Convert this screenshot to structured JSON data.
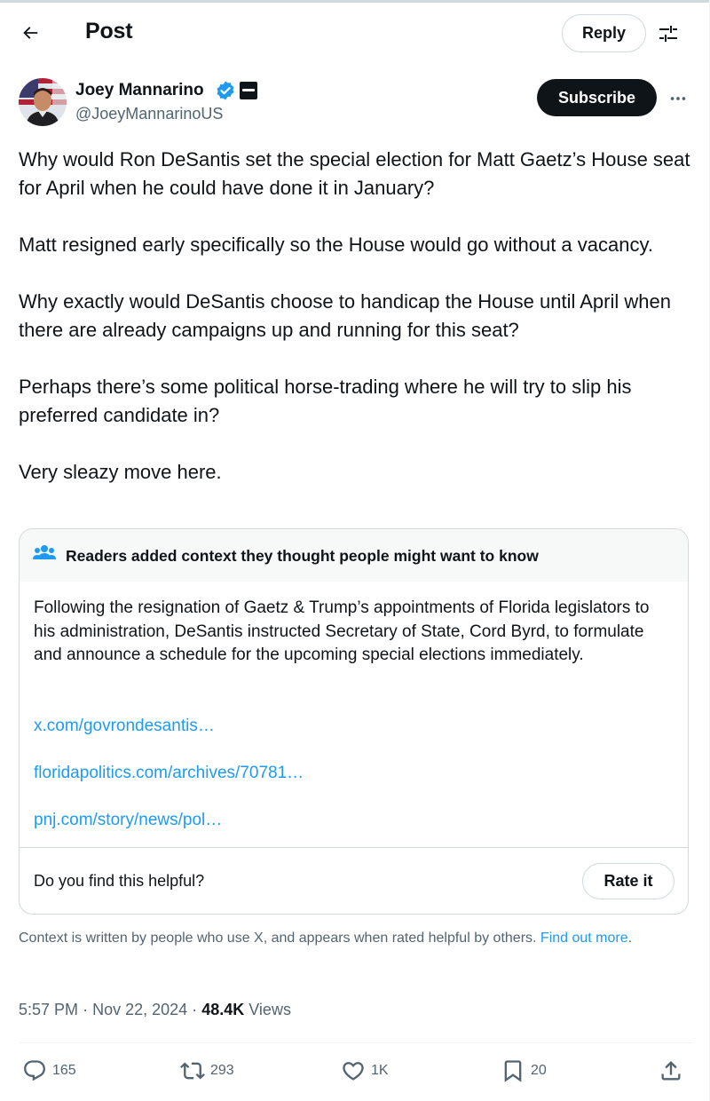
{
  "header": {
    "title": "Post",
    "reply_label": "Reply"
  },
  "author": {
    "name": "Joey Mannarino",
    "handle": "@JoeyMannarinoUS",
    "subscribe_label": "Subscribe"
  },
  "tweet": {
    "paragraphs": [
      "Why would Ron DeSantis set the special election for Matt Gaetz’s House seat for April when he could have done it in January?",
      "Matt resigned early specifically so the House would go without a vacancy.",
      "Why exactly would DeSantis choose to handicap the House until April when there are already campaigns up and running for this seat?",
      "Perhaps there’s some political horse-trading where he will try to slip his preferred candidate in?",
      "Very sleazy move here."
    ]
  },
  "community_note": {
    "title": "Readers added context they thought people might want to know",
    "body": "Following the resignation of Gaetz & Trump’s appointments of Florida legislators to his administration, DeSantis instructed Secretary of State, Cord Byrd, to formulate and announce a schedule for the upcoming special elections immediately.",
    "links": [
      "x.com/govrondesantis…",
      "floridapolitics.com/archives/70781…",
      "pnj.com/story/news/pol…"
    ],
    "question": "Do you find this helpful?",
    "rate_label": "Rate it",
    "footer_text": "Context is written by people who use X, and appears when rated helpful by others.",
    "footer_link": "Find out more",
    "footer_period": "."
  },
  "meta": {
    "time": "5:57 PM",
    "separator": "·",
    "date": "Nov 22, 2024",
    "views_count": "48.4K",
    "views_label": "Views"
  },
  "actions": {
    "replies": "165",
    "reposts": "293",
    "likes": "1K",
    "bookmarks": "20"
  },
  "colors": {
    "accent": "#1d9bf0",
    "text": "#0f1419",
    "secondary": "#536471",
    "border": "#cfd9de"
  }
}
